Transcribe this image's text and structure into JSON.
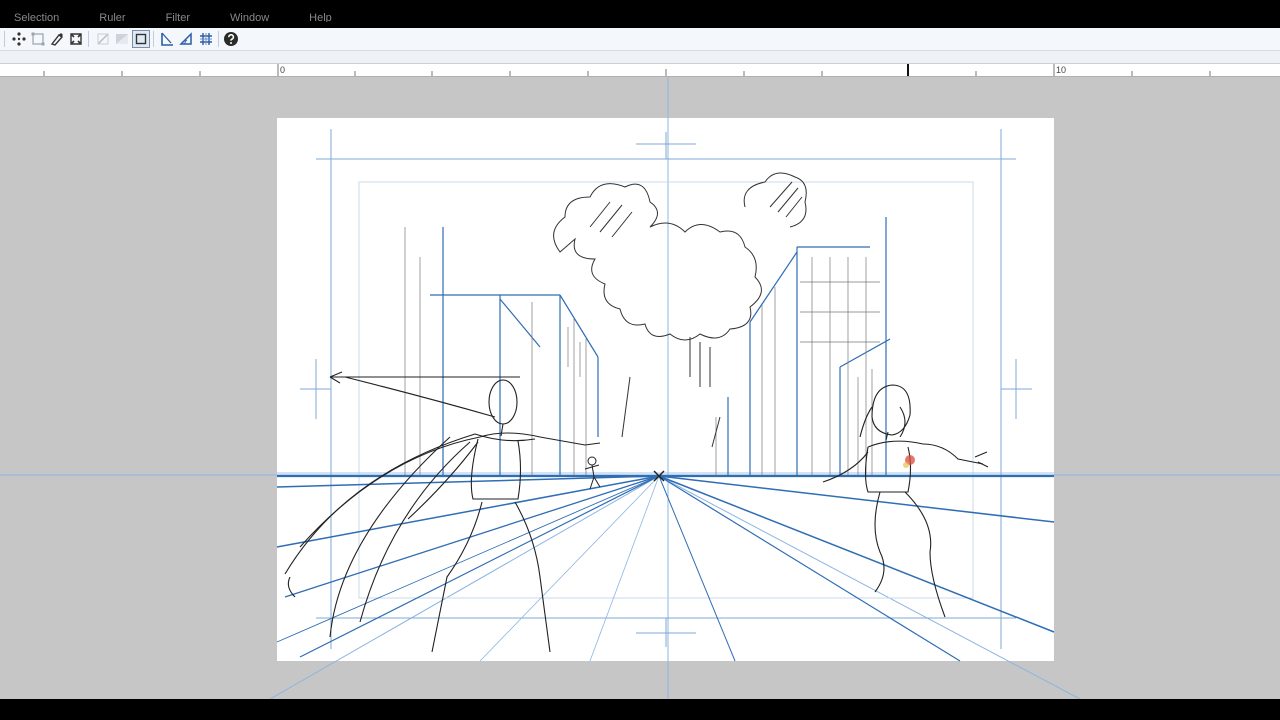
{
  "menu": {
    "items": [
      "Selection",
      "Ruler",
      "Filter",
      "Window",
      "Help"
    ]
  },
  "toolbar": {
    "buttons": [
      {
        "name": "selection-move-icon"
      },
      {
        "name": "transform-icon"
      },
      {
        "name": "pen-tool-icon"
      },
      {
        "name": "free-transform-icon"
      },
      {
        "name": "ruler-disabled-icon"
      },
      {
        "name": "gradient-disabled-icon"
      },
      {
        "name": "frame-select-icon"
      },
      {
        "name": "perspective-ruler-icon"
      },
      {
        "name": "angle-ruler-icon"
      },
      {
        "name": "grid-snap-icon"
      },
      {
        "name": "help-icon"
      }
    ]
  },
  "ruler": {
    "label_zero": "0",
    "label_ten": "10"
  },
  "canvas": {
    "guide_color": "#8db4e2",
    "perspective_color": "#2f6db5",
    "sketch_color": "#333333"
  }
}
